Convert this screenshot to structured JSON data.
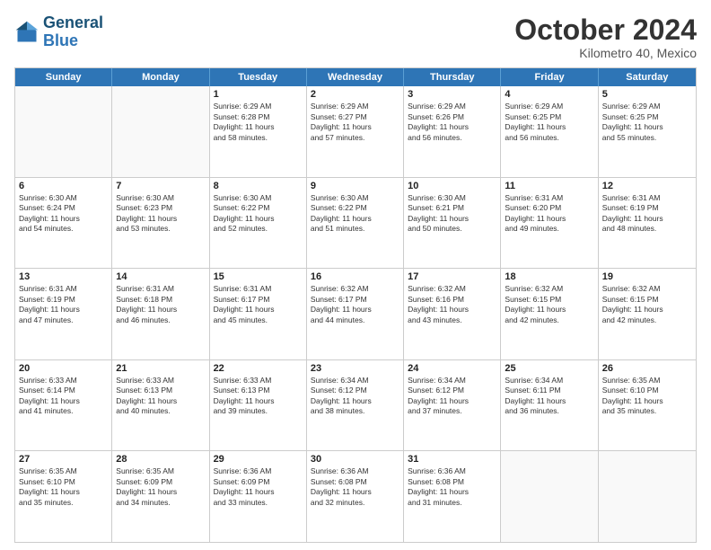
{
  "header": {
    "logo_line1": "General",
    "logo_line2": "Blue",
    "month": "October 2024",
    "location": "Kilometro 40, Mexico"
  },
  "days_of_week": [
    "Sunday",
    "Monday",
    "Tuesday",
    "Wednesday",
    "Thursday",
    "Friday",
    "Saturday"
  ],
  "weeks": [
    [
      {
        "day": "",
        "info": ""
      },
      {
        "day": "",
        "info": ""
      },
      {
        "day": "1",
        "info": "Sunrise: 6:29 AM\nSunset: 6:28 PM\nDaylight: 11 hours\nand 58 minutes."
      },
      {
        "day": "2",
        "info": "Sunrise: 6:29 AM\nSunset: 6:27 PM\nDaylight: 11 hours\nand 57 minutes."
      },
      {
        "day": "3",
        "info": "Sunrise: 6:29 AM\nSunset: 6:26 PM\nDaylight: 11 hours\nand 56 minutes."
      },
      {
        "day": "4",
        "info": "Sunrise: 6:29 AM\nSunset: 6:25 PM\nDaylight: 11 hours\nand 56 minutes."
      },
      {
        "day": "5",
        "info": "Sunrise: 6:29 AM\nSunset: 6:25 PM\nDaylight: 11 hours\nand 55 minutes."
      }
    ],
    [
      {
        "day": "6",
        "info": "Sunrise: 6:30 AM\nSunset: 6:24 PM\nDaylight: 11 hours\nand 54 minutes."
      },
      {
        "day": "7",
        "info": "Sunrise: 6:30 AM\nSunset: 6:23 PM\nDaylight: 11 hours\nand 53 minutes."
      },
      {
        "day": "8",
        "info": "Sunrise: 6:30 AM\nSunset: 6:22 PM\nDaylight: 11 hours\nand 52 minutes."
      },
      {
        "day": "9",
        "info": "Sunrise: 6:30 AM\nSunset: 6:22 PM\nDaylight: 11 hours\nand 51 minutes."
      },
      {
        "day": "10",
        "info": "Sunrise: 6:30 AM\nSunset: 6:21 PM\nDaylight: 11 hours\nand 50 minutes."
      },
      {
        "day": "11",
        "info": "Sunrise: 6:31 AM\nSunset: 6:20 PM\nDaylight: 11 hours\nand 49 minutes."
      },
      {
        "day": "12",
        "info": "Sunrise: 6:31 AM\nSunset: 6:19 PM\nDaylight: 11 hours\nand 48 minutes."
      }
    ],
    [
      {
        "day": "13",
        "info": "Sunrise: 6:31 AM\nSunset: 6:19 PM\nDaylight: 11 hours\nand 47 minutes."
      },
      {
        "day": "14",
        "info": "Sunrise: 6:31 AM\nSunset: 6:18 PM\nDaylight: 11 hours\nand 46 minutes."
      },
      {
        "day": "15",
        "info": "Sunrise: 6:31 AM\nSunset: 6:17 PM\nDaylight: 11 hours\nand 45 minutes."
      },
      {
        "day": "16",
        "info": "Sunrise: 6:32 AM\nSunset: 6:17 PM\nDaylight: 11 hours\nand 44 minutes."
      },
      {
        "day": "17",
        "info": "Sunrise: 6:32 AM\nSunset: 6:16 PM\nDaylight: 11 hours\nand 43 minutes."
      },
      {
        "day": "18",
        "info": "Sunrise: 6:32 AM\nSunset: 6:15 PM\nDaylight: 11 hours\nand 42 minutes."
      },
      {
        "day": "19",
        "info": "Sunrise: 6:32 AM\nSunset: 6:15 PM\nDaylight: 11 hours\nand 42 minutes."
      }
    ],
    [
      {
        "day": "20",
        "info": "Sunrise: 6:33 AM\nSunset: 6:14 PM\nDaylight: 11 hours\nand 41 minutes."
      },
      {
        "day": "21",
        "info": "Sunrise: 6:33 AM\nSunset: 6:13 PM\nDaylight: 11 hours\nand 40 minutes."
      },
      {
        "day": "22",
        "info": "Sunrise: 6:33 AM\nSunset: 6:13 PM\nDaylight: 11 hours\nand 39 minutes."
      },
      {
        "day": "23",
        "info": "Sunrise: 6:34 AM\nSunset: 6:12 PM\nDaylight: 11 hours\nand 38 minutes."
      },
      {
        "day": "24",
        "info": "Sunrise: 6:34 AM\nSunset: 6:12 PM\nDaylight: 11 hours\nand 37 minutes."
      },
      {
        "day": "25",
        "info": "Sunrise: 6:34 AM\nSunset: 6:11 PM\nDaylight: 11 hours\nand 36 minutes."
      },
      {
        "day": "26",
        "info": "Sunrise: 6:35 AM\nSunset: 6:10 PM\nDaylight: 11 hours\nand 35 minutes."
      }
    ],
    [
      {
        "day": "27",
        "info": "Sunrise: 6:35 AM\nSunset: 6:10 PM\nDaylight: 11 hours\nand 35 minutes."
      },
      {
        "day": "28",
        "info": "Sunrise: 6:35 AM\nSunset: 6:09 PM\nDaylight: 11 hours\nand 34 minutes."
      },
      {
        "day": "29",
        "info": "Sunrise: 6:36 AM\nSunset: 6:09 PM\nDaylight: 11 hours\nand 33 minutes."
      },
      {
        "day": "30",
        "info": "Sunrise: 6:36 AM\nSunset: 6:08 PM\nDaylight: 11 hours\nand 32 minutes."
      },
      {
        "day": "31",
        "info": "Sunrise: 6:36 AM\nSunset: 6:08 PM\nDaylight: 11 hours\nand 31 minutes."
      },
      {
        "day": "",
        "info": ""
      },
      {
        "day": "",
        "info": ""
      }
    ]
  ]
}
